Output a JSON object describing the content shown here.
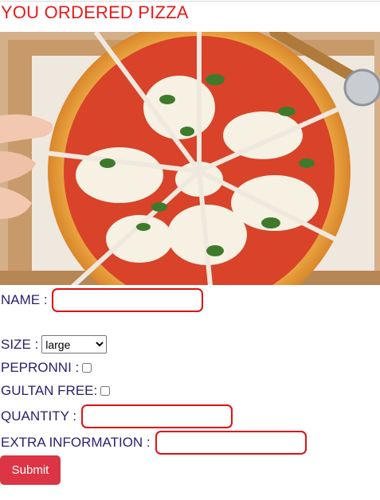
{
  "page": {
    "title": "YOU ORDERED PIZZA"
  },
  "colors": {
    "title": "#e81a1a",
    "label": "#2b2170",
    "field_border": "#e01010",
    "submit_bg": "#dc3545"
  },
  "image": {
    "icon": "pizza-photo"
  },
  "form": {
    "name_label": "NAME :",
    "size_label": "SIZE :",
    "size_selected": "large",
    "pepperoni_label": "PEPRONNI :",
    "gluten_label": "GULTAN FREE:",
    "quantity_label": "QUANTITY :",
    "extra_label": "EXTRA INFORMATION :",
    "submit_label": "Submit"
  }
}
